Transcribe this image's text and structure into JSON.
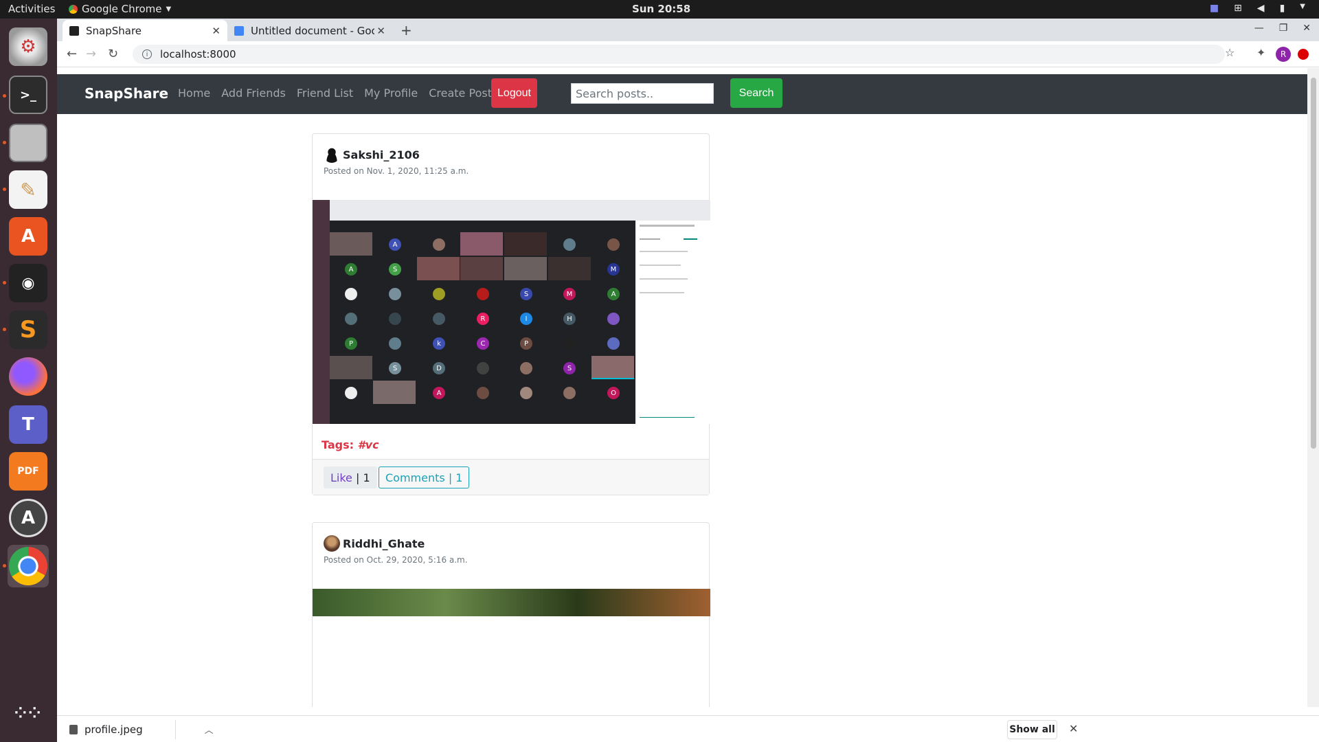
{
  "system": {
    "activities": "Activities",
    "app_name": "Google Chrome",
    "clock": "Sun 20:58"
  },
  "browser": {
    "tabs": [
      {
        "label": "SnapShare",
        "active": true
      },
      {
        "label": "Untitled document - Goog",
        "active": false
      }
    ],
    "url": "localhost:8000",
    "profile_initial": "R"
  },
  "site": {
    "brand": "SnapShare",
    "nav": [
      "Home",
      "Add Friends",
      "Friend List",
      "My Profile",
      "Create Post"
    ],
    "logout": "Logout",
    "search_placeholder": "Search posts..",
    "search_button": "Search"
  },
  "posts": [
    {
      "author": "Sakshi_2106",
      "posted": "Posted on Nov. 1, 2020, 11:25 a.m.",
      "tags_label": "Tags:",
      "tag": "#vc",
      "like_label": "Like",
      "like_sep": " | ",
      "like_count": "1",
      "comments_label": "Comments | 1"
    },
    {
      "author": "Riddhi_Ghate",
      "posted": "Posted on Oct. 29, 2020, 5:16 a.m."
    }
  ],
  "downloads": {
    "file": "profile.jpeg",
    "show_all": "Show all"
  },
  "colors": {
    "navbar": "#343a40",
    "logout": "#dc3545",
    "search": "#28a745",
    "tags": "#dc3545",
    "comments": "#17a2b8"
  }
}
